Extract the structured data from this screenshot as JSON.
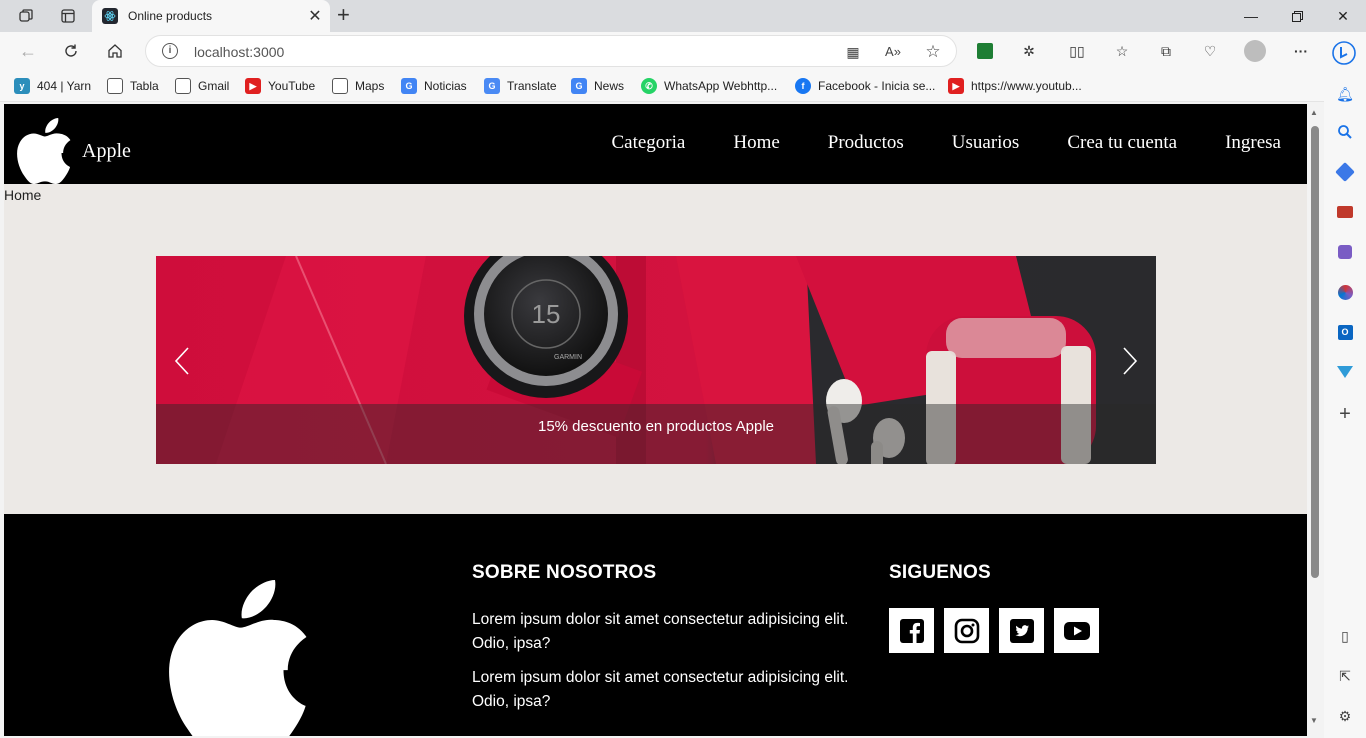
{
  "browser": {
    "tab_title": "Online products",
    "url_host": "localhost",
    "url_port": ":3000",
    "bookmarks": [
      {
        "label": "404 | Yarn",
        "icon": "yarn-icon"
      },
      {
        "label": "Tabla",
        "icon": "page-icon"
      },
      {
        "label": "Gmail",
        "icon": "page-icon"
      },
      {
        "label": "YouTube",
        "icon": "youtube-icon"
      },
      {
        "label": "Maps",
        "icon": "page-icon"
      },
      {
        "label": "Noticias",
        "icon": "google-news-icon"
      },
      {
        "label": "Translate",
        "icon": "translate-icon"
      },
      {
        "label": "News",
        "icon": "google-news-icon"
      },
      {
        "label": "WhatsApp Webhttp...",
        "icon": "whatsapp-icon"
      },
      {
        "label": "Facebook - Inicia se...",
        "icon": "facebook-icon"
      },
      {
        "label": "https://www.youtub...",
        "icon": "youtube-icon"
      }
    ]
  },
  "site": {
    "brand": "Apple",
    "menu": [
      "Categoria",
      "Home",
      "Productos",
      "Usuarios",
      "Crea tu cuenta",
      "Ingresa"
    ],
    "breadcrumb": "Home",
    "carousel": {
      "caption": "15% descuento en productos Apple",
      "watch_number": "15",
      "watch_brand": "GARMIN"
    },
    "footer": {
      "about_title": "SOBRE NOSOTROS",
      "about_p1": "Lorem ipsum dolor sit amet consectetur adipisicing elit. Odio, ipsa?",
      "about_p2": "Lorem ipsum dolor sit amet consectetur adipisicing elit. Odio, ipsa?",
      "follow_title": "SIGUENOS",
      "socials": [
        "facebook-icon",
        "instagram-icon",
        "twitter-icon",
        "youtube-icon"
      ]
    }
  },
  "colors": {
    "header_bg": "#000000",
    "page_bg": "#ece9e6",
    "accent_red": "#d5123f"
  }
}
